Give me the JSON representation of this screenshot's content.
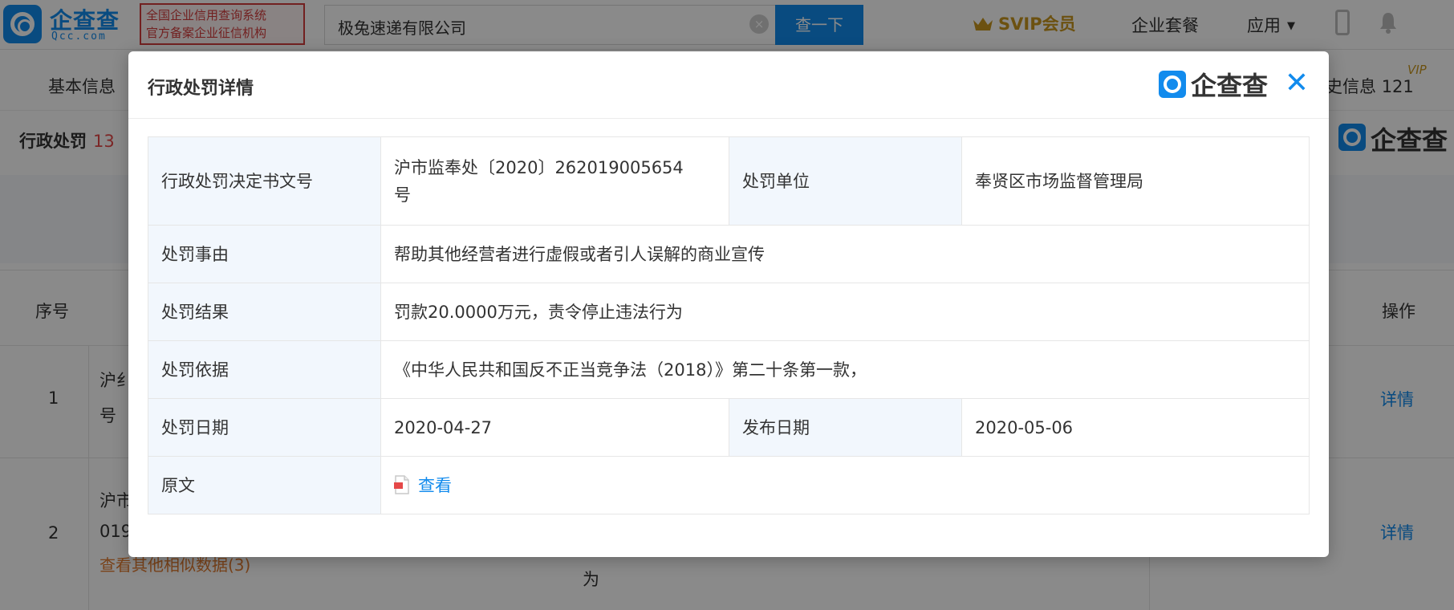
{
  "topbar": {
    "logo_name": "企查查",
    "logo_domain": "Qcc.com",
    "badge_line1": "全国企业信用查询系统",
    "badge_line2": "官方备案企业征信机构",
    "search_value": "极兔速递有限公司",
    "search_button": "查一下",
    "svip_label": "SVIP会员",
    "nav_package": "企业套餐",
    "nav_apps": "应用",
    "icons": [
      "search-clear-icon",
      "crown-icon",
      "chevron-down-icon",
      "phone-icon",
      "bell-icon"
    ],
    "brand_color": "#128bed",
    "vip_color": "#c8961e"
  },
  "subnav": {
    "basic_info": "基本信息",
    "history_info": "史信息",
    "history_count": "121",
    "vip_tag": "VIP"
  },
  "section": {
    "title": "行政处罚",
    "count": "13",
    "watermark": "企查查"
  },
  "table": {
    "col_index": "序号",
    "col_action": "操作",
    "rows": [
      {
        "index": "1",
        "doc_part1": "沪纟",
        "doc_part2": "号",
        "action": "详情"
      },
      {
        "index": "2",
        "doc_part1": "沪市",
        "doc_part2": "019",
        "action": "详情"
      }
    ],
    "similar_link": "查看其他相似数据(3)",
    "stray_text": "为"
  },
  "modal": {
    "title": "行政处罚详情",
    "logo_text": "企查查",
    "close_glyph": "✕",
    "rows": {
      "doc_number_label": "行政处罚决定书文号",
      "doc_number_value_line1": "沪市监奉处〔2020〕262019005654",
      "doc_number_value_line2": "号",
      "unit_label": "处罚单位",
      "unit_value": "奉贤区市场监督管理局",
      "reason_label": "处罚事由",
      "reason_value": "帮助其他经营者进行虚假或者引人误解的商业宣传",
      "result_label": "处罚结果",
      "result_value": "罚款20.0000万元，责令停止违法行为",
      "basis_label": "处罚依据",
      "basis_value": "《中华人民共和国反不正当竞争法（2018）》第二十条第一款，",
      "date_label": "处罚日期",
      "date_value": "2020-04-27",
      "publish_label": "发布日期",
      "publish_value": "2020-05-06",
      "original_label": "原文",
      "original_link": "查看"
    }
  }
}
